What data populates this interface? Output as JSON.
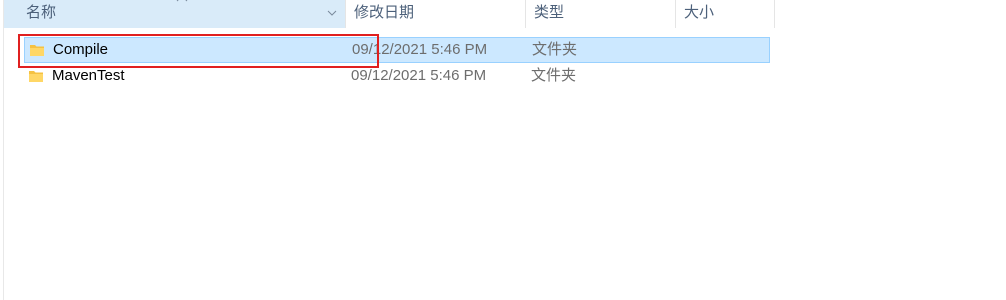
{
  "columns": {
    "name": "名称",
    "date": "修改日期",
    "type": "类型",
    "size": "大小"
  },
  "rows": [
    {
      "name": "Compile",
      "date": "09/12/2021 5:46 PM",
      "type": "文件夹",
      "size": "",
      "selected": true
    },
    {
      "name": "MavenTest",
      "date": "09/12/2021 5:46 PM",
      "type": "文件夹",
      "size": "",
      "selected": false
    }
  ],
  "icons": {
    "folder": "folder-icon",
    "sort": "sort-ascending-icon",
    "column_menu": "chevron-down-icon"
  },
  "colors": {
    "selection_fill": "#cce8ff",
    "selection_border": "#99d1ff",
    "annotation_box": "#e02020",
    "folder": "#f5c242"
  }
}
